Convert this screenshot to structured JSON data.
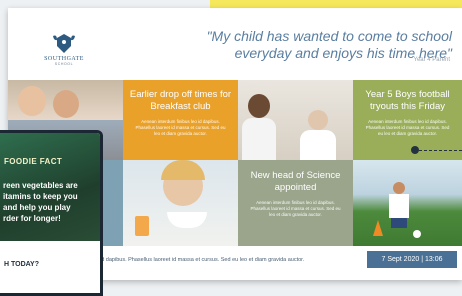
{
  "header": {
    "school_name": "SOUTHGATE",
    "school_sub": "SCHOOL",
    "quote": "\"My child has wanted to come to school everyday and enjoys his time here\"",
    "quote_by": "Year 4 Parent"
  },
  "tiles": {
    "breakfast": {
      "title": "Earlier drop off times for Breakfast club",
      "body": "Aenean interdum finibus leo id dapibus. Phasellus laoreet id massa et cursus. Sed eu leo et diam gravida auctor."
    },
    "football": {
      "title": "Year 5 Boys football tryouts this Friday",
      "body": "Aenean interdum finibus leo id dapibus. Phasellus laoreet id massa et cursus. Sed eu leo et diam gravida auctor."
    },
    "science": {
      "title": "New head of Science appointed",
      "body": "Aenean interdum finibus leo id dapibus. Phasellus laoreet id massa et cursus. Sed eu leo et diam gravida auctor."
    }
  },
  "footer": {
    "ticker": "id dapibus. Phasellus laoreet id massa et cursus. Sed eu leo et diam gravida auctor.",
    "datetime": "7 Sept 2020 | 13:06"
  },
  "phone": {
    "label": "FOODIE FACT",
    "body_lines": [
      "reen vegetables are",
      "itamins to keep you",
      "and help you play",
      "rder for longer!"
    ],
    "question": "H TODAY?"
  },
  "colors": {
    "accent_yellow": "#f6e85c",
    "tile_orange": "#e9a12a",
    "tile_green": "#9aae5a",
    "tile_sage": "#9aa58c",
    "badge_blue": "#4a7195"
  }
}
